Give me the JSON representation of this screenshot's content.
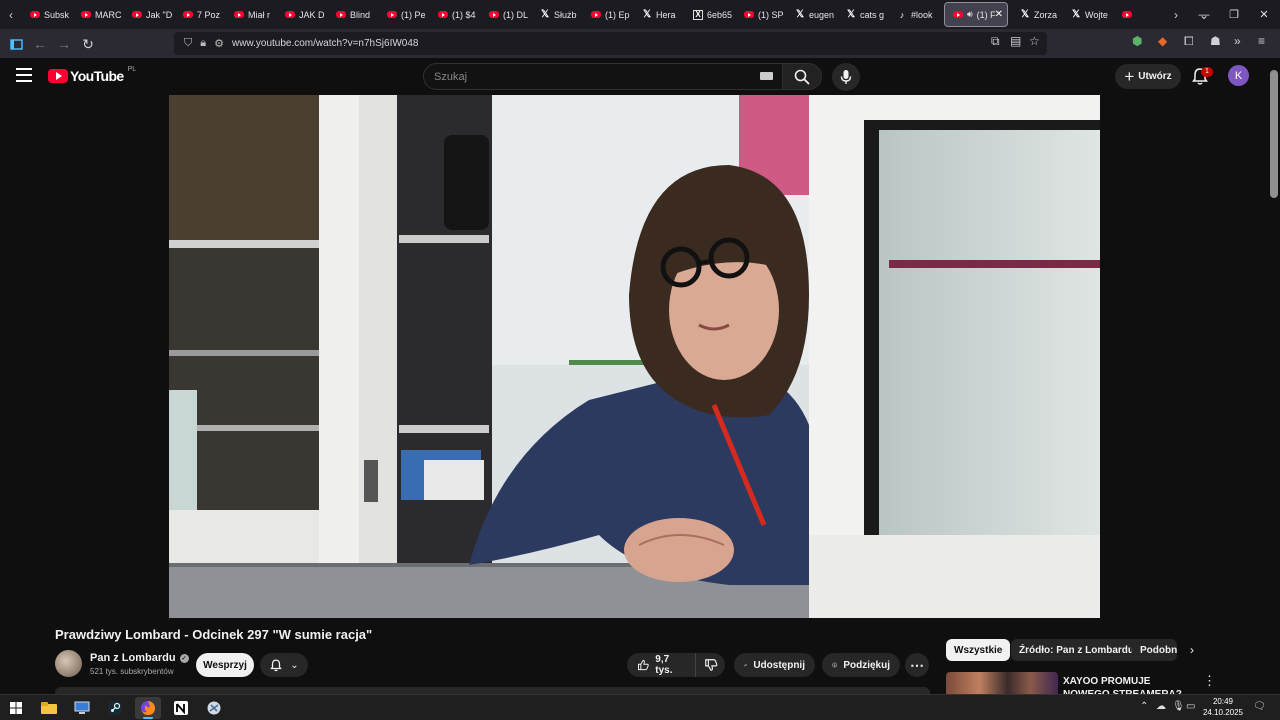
{
  "browser": {
    "tabs": [
      {
        "favicon": "youtube-icon",
        "label": "Subsk"
      },
      {
        "favicon": "youtube-icon",
        "label": "MARC"
      },
      {
        "favicon": "youtube-icon",
        "label": "Jak \"D"
      },
      {
        "favicon": "youtube-icon",
        "label": "7 Poz"
      },
      {
        "favicon": "youtube-icon",
        "label": "Miał r"
      },
      {
        "favicon": "youtube-icon",
        "label": "JAK D"
      },
      {
        "favicon": "youtube-icon",
        "label": "Blind"
      },
      {
        "favicon": "youtube-icon",
        "label": "(1) Pe"
      },
      {
        "favicon": "youtube-icon",
        "label": "(1) $4"
      },
      {
        "favicon": "youtube-icon",
        "label": "(1) DL"
      },
      {
        "favicon": "x-icon",
        "label": "Służb"
      },
      {
        "favicon": "youtube-icon",
        "label": "(1) Ep"
      },
      {
        "favicon": "x-icon",
        "label": "Hera"
      },
      {
        "favicon": "xbox-x-icon",
        "label": "6eb65"
      },
      {
        "favicon": "youtube-icon",
        "label": "(1) SP"
      },
      {
        "favicon": "x-icon",
        "label": "eugen"
      },
      {
        "favicon": "x-icon",
        "label": "cats g"
      },
      {
        "favicon": "tiktok-icon",
        "label": "#look"
      },
      {
        "favicon": "youtube-icon",
        "label": "(1) F",
        "active": true,
        "audio": true
      },
      {
        "favicon": "x-icon",
        "label": "Zorza"
      },
      {
        "favicon": "x-icon",
        "label": "Wojte"
      },
      {
        "favicon": "youtube-icon",
        "label": ""
      }
    ],
    "tab_close_glyph": "✕",
    "url": "www.youtube.com/watch?v=n7hSj6IW048"
  },
  "youtube": {
    "logo_text": "YouTube",
    "country_code": "PL",
    "search_placeholder": "Szukaj",
    "create_label": "Utwórz",
    "notification_count": "1",
    "avatar_letter": "K",
    "video_title": "Prawdziwy Lombard - Odcinek 297 \"W sumie racja\"",
    "channel_name": "Pan z Lombardu",
    "subscribers": "521 tys. subskrybentów",
    "join_label": "Wesprzyj",
    "likes": "9,7 tys.",
    "share_label": "Udostępnij",
    "thanks_label": "Podziękuj",
    "chips": [
      "Wszystkie",
      "Źródło: Pan z Lombardu",
      "Podobne"
    ],
    "recommendation_title": "XAYOO PROMUJE NOWEGO STREAMERA? RENATA I"
  },
  "taskbar": {
    "time": "20:49",
    "date": "24.10.2025"
  },
  "colors": {
    "yt_red": "#ff0033",
    "background": "#0f0f0f",
    "avatar": "#7e57c2"
  }
}
